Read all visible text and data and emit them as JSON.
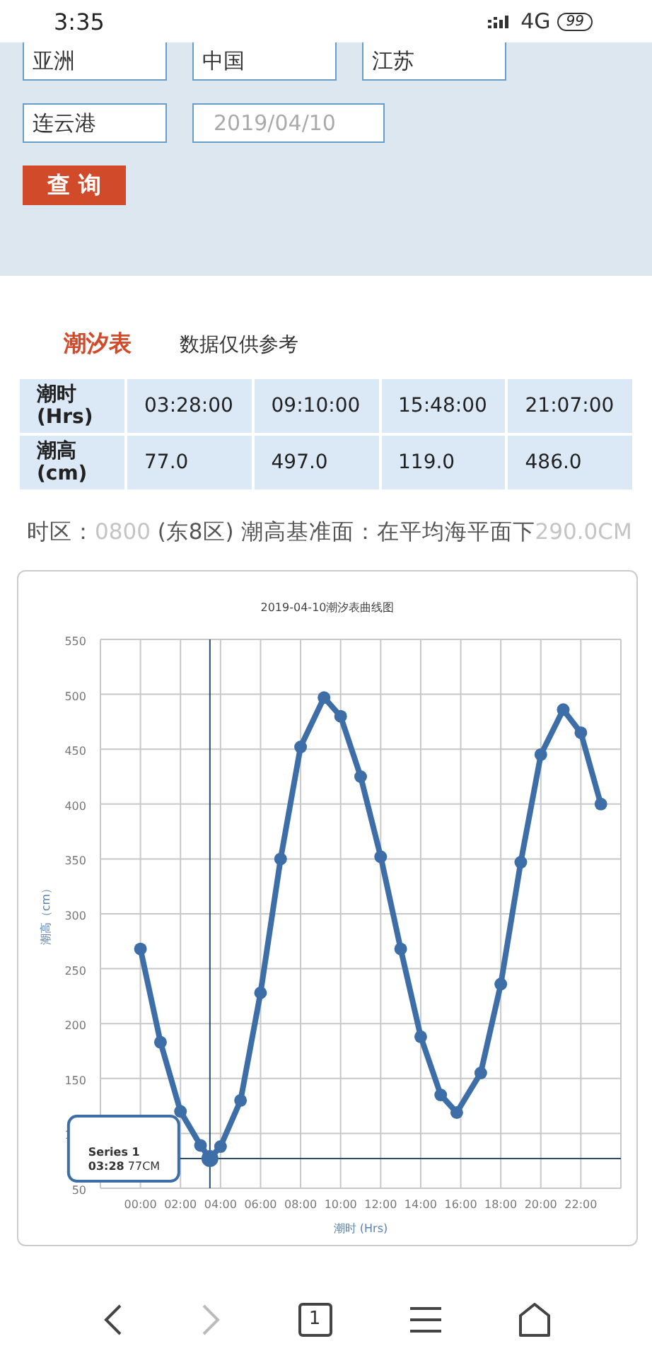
{
  "status_bar": {
    "time": "3:35",
    "network": "4G",
    "battery": "99"
  },
  "form": {
    "rows": [
      [
        {
          "value": "亚洲"
        },
        {
          "value": "中国"
        },
        {
          "value": "江苏"
        }
      ],
      [
        {
          "value": "连云港"
        },
        {
          "placeholder": "2019/04/10"
        }
      ]
    ],
    "button": "查 询"
  },
  "tide": {
    "title": "潮汐表",
    "note": "数据仅供参考",
    "table": {
      "rows": [
        {
          "label": "潮时\n(Hrs)",
          "cells": [
            "03:28:00",
            "09:10:00",
            "15:48:00",
            "21:07:00"
          ]
        },
        {
          "label": "潮高\n(cm)",
          "cells": [
            "77.0",
            "497.0",
            "119.0",
            "486.0"
          ]
        }
      ]
    },
    "info": [
      {
        "text": "时区：",
        "faint": false
      },
      {
        "text": "0800",
        "faint": true
      },
      {
        "text": " (东8区) 潮高基准面：在平均海平面下",
        "faint": false
      },
      {
        "text": "290.0CM",
        "faint": true
      }
    ]
  },
  "chart": {
    "chart_data": {
      "type": "line",
      "title": "2019-04-10潮汐表曲线图",
      "xlabel": "潮时 (Hrs)",
      "ylabel": "潮高（cm）",
      "x": [
        0,
        1,
        2,
        3,
        3.47,
        4,
        5,
        6,
        7,
        8,
        9.17,
        10,
        11,
        12,
        13,
        14,
        15,
        15.8,
        17,
        18,
        19,
        20,
        21.12,
        22,
        23
      ],
      "series": [
        {
          "name": "Series 1",
          "color": "#3d6ea8",
          "marker": "o",
          "values": [
            268,
            183,
            120,
            89,
            77,
            88,
            130,
            228,
            350,
            452,
            497,
            480,
            425,
            352,
            268,
            188,
            135,
            119,
            155,
            236,
            347,
            445,
            486,
            465,
            400
          ]
        }
      ],
      "xlim": [
        -2,
        24
      ],
      "ylim": [
        50,
        550
      ],
      "xticks": [
        {
          "value": 0,
          "label": "00:00"
        },
        {
          "value": 2,
          "label": "02:00"
        },
        {
          "value": 4,
          "label": "04:00"
        },
        {
          "value": 6,
          "label": "06:00"
        },
        {
          "value": 8,
          "label": "08:00"
        },
        {
          "value": 10,
          "label": "10:00"
        },
        {
          "value": 12,
          "label": "12:00"
        },
        {
          "value": 14,
          "label": "14:00"
        },
        {
          "value": 16,
          "label": "16:00"
        },
        {
          "value": 18,
          "label": "18:00"
        },
        {
          "value": 20,
          "label": "20:00"
        },
        {
          "value": 22,
          "label": "22:00"
        }
      ],
      "yticks": [
        50,
        100,
        150,
        200,
        250,
        300,
        350,
        400,
        450,
        500,
        550
      ],
      "grid": true,
      "ref_lines": [
        {
          "axis": "x",
          "value": 3.47
        },
        {
          "axis": "y",
          "value": 77
        }
      ]
    },
    "tooltip": {
      "time": "03:28",
      "value": "77CM"
    }
  },
  "nav": {
    "tabs": "1"
  }
}
